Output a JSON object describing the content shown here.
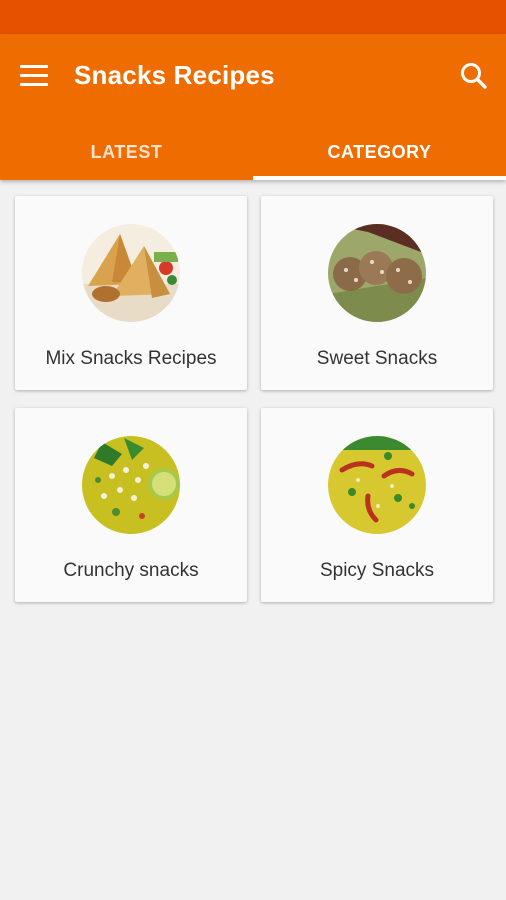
{
  "app": {
    "title": "Snacks Recipes"
  },
  "tabs": [
    {
      "label": "LATEST",
      "active": false
    },
    {
      "label": "CATEGORY",
      "active": true
    }
  ],
  "categories": [
    {
      "label": "Mix Snacks Recipes",
      "image": "samosa-image"
    },
    {
      "label": "Sweet Snacks",
      "image": "laddu-image"
    },
    {
      "label": "Crunchy snacks",
      "image": "poha-image"
    },
    {
      "label": "Spicy Snacks",
      "image": "spicy-poha-image"
    }
  ],
  "colors": {
    "status_bar": "#e65100",
    "app_bar": "#ef6c00",
    "background": "#f1f1f1"
  },
  "icons": {
    "menu": "hamburger-menu-icon",
    "search": "search-icon"
  }
}
